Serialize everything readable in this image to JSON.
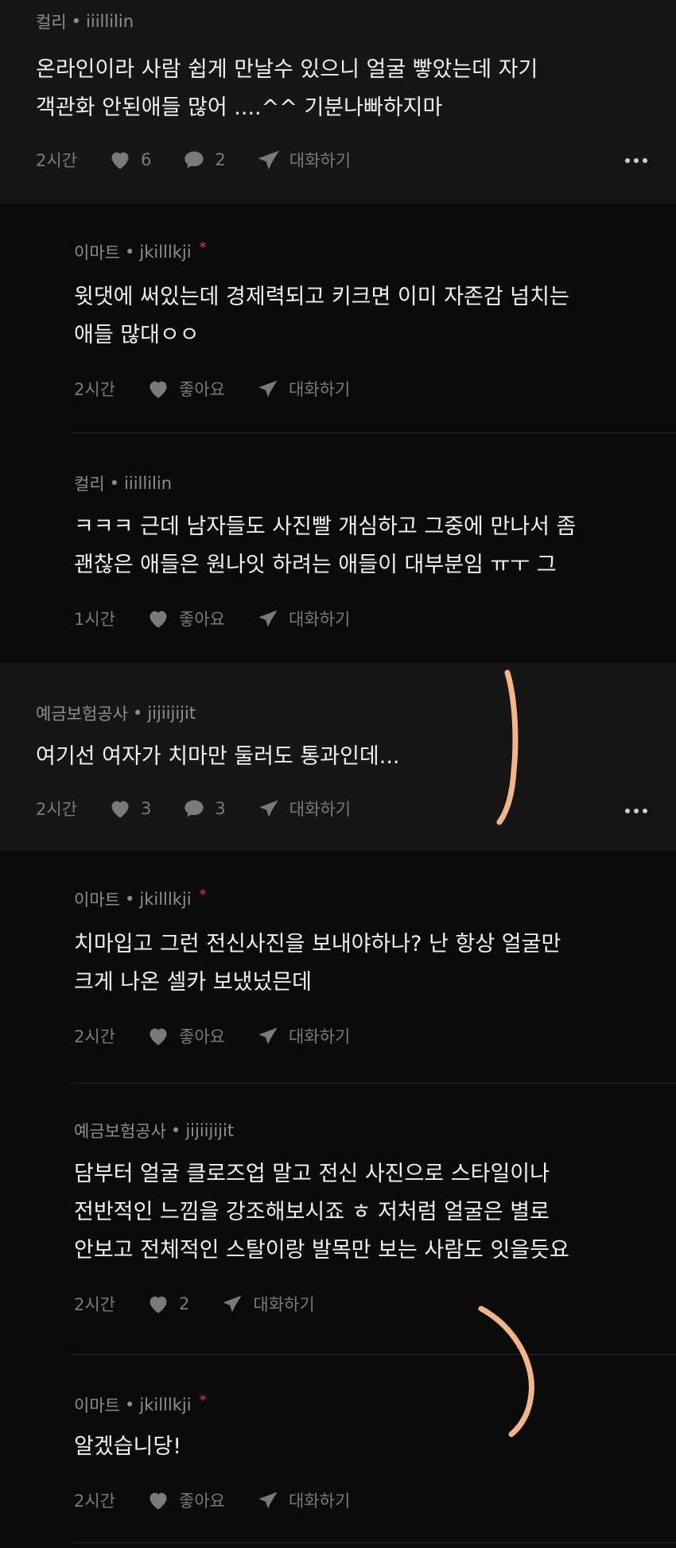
{
  "comments": [
    {
      "nick": "컬리",
      "user": "iiillilin",
      "text": "온라인이라 사람 쉽게 만날수 있으니 얼굴 빻았는데 자기\n객관화 안된애들 많어 ....^^ 기분나빠하지마",
      "time": "2시간",
      "likes": "6",
      "replies": "2",
      "chat": "대화하기"
    },
    {
      "nick": "이마트",
      "user": "jkilllkji",
      "text": "윗댓에 써있는데 경제력되고 키크면 이미 자존감 넘치는\n애들 많대ㅇㅇ",
      "time": "2시간",
      "like_label": "좋아요",
      "chat": "대화하기"
    },
    {
      "nick": "컬리",
      "user": "iiillilin",
      "text": "ㅋㅋㅋ 근데 남자들도 사진빨 개심하고 그중에 만나서 좀\n괜찮은 애들은 원나잇 하려는 애들이 대부분임 ㅠㅜ 그",
      "time": "1시간",
      "like_label": "좋아요",
      "chat": "대화하기"
    },
    {
      "nick": "예금보험공사",
      "user": "jijiijijit",
      "text": "여기선 여자가 치마만 둘러도 통과인데...",
      "time": "2시간",
      "likes": "3",
      "replies": "3",
      "chat": "대화하기"
    },
    {
      "nick": "이마트",
      "user": "jkilllkji",
      "text": "치마입고 그런 전신사진을 보내야하나? 난 항상 얼굴만\n크게 나온 셀카 보냈넜믄데",
      "time": "2시간",
      "like_label": "좋아요",
      "chat": "대화하기"
    },
    {
      "nick": "예금보험공사",
      "user": "jijiijijit",
      "text": "담부터 얼굴 클로즈업 말고 전신 사진으로 스타일이나\n전반적인 느낌을 강조해보시죠 ㅎ 저처럼 얼굴은 별로\n안보고 전체적인 스탈이랑 발목만 보는 사람도 잇을듯요",
      "time": "2시간",
      "likes": "2",
      "chat": "대화하기"
    },
    {
      "nick": "이마트",
      "user": "jkilllkji",
      "text": "알겠습니당!",
      "time": "2시간",
      "like_label": "좋아요",
      "chat": "대화하기"
    }
  ],
  "colors": {
    "accent_star": "#e0394a",
    "scribble": "#f2b48a"
  }
}
